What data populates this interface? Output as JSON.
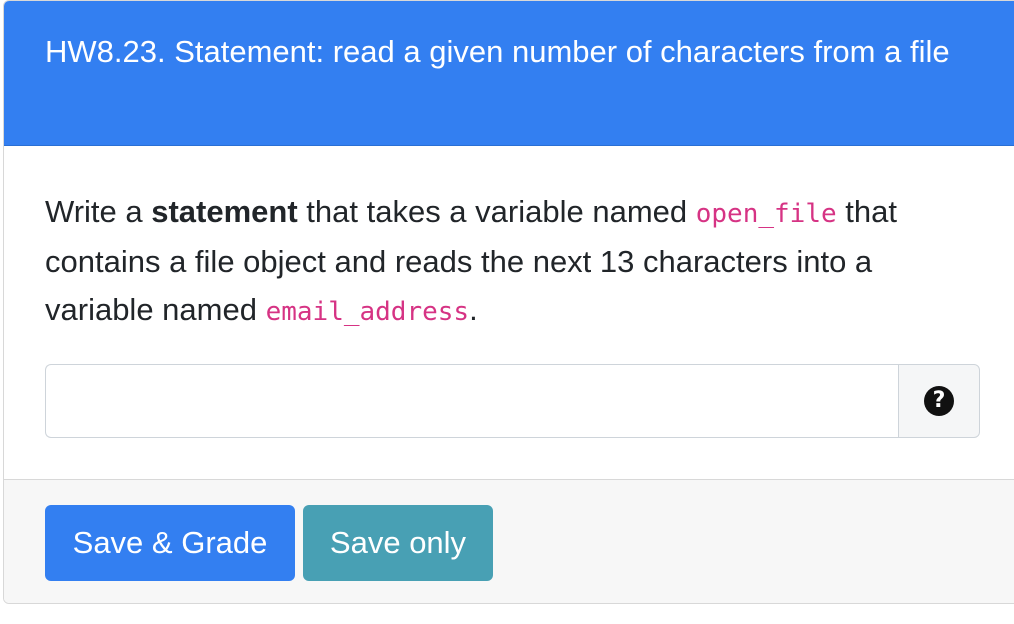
{
  "header": {
    "title": "HW8.23. Statement: read a given number of characters from a file"
  },
  "question": {
    "text_1": "Write a ",
    "bold_word": "statement",
    "text_2": " that takes a variable named ",
    "var_1": "open_file",
    "text_3": " that contains a file object and reads the next 13 characters into a variable named ",
    "var_2": "email_address",
    "text_4": "."
  },
  "answer": {
    "value": "",
    "placeholder": ""
  },
  "help": {
    "icon": "question-circle-icon",
    "glyph": "?"
  },
  "footer": {
    "save_grade_label": "Save & Grade",
    "save_only_label": "Save only"
  },
  "colors": {
    "header_bg": "#337ff1",
    "primary_button": "#337ff1",
    "secondary_button": "#48a0b4",
    "code_text": "#d63384"
  }
}
